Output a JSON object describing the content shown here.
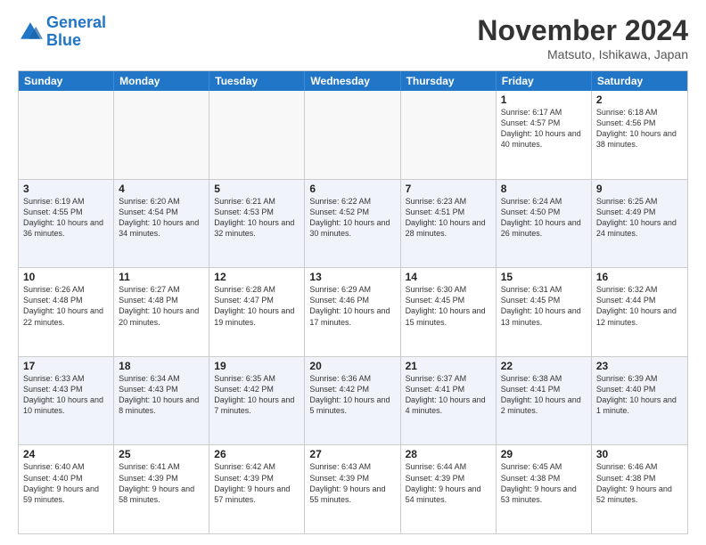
{
  "header": {
    "logo_line1": "General",
    "logo_line2": "Blue",
    "month_title": "November 2024",
    "location": "Matsuto, Ishikawa, Japan"
  },
  "days_of_week": [
    "Sunday",
    "Monday",
    "Tuesday",
    "Wednesday",
    "Thursday",
    "Friday",
    "Saturday"
  ],
  "rows": [
    {
      "alt": false,
      "cells": [
        {
          "day": "",
          "info": ""
        },
        {
          "day": "",
          "info": ""
        },
        {
          "day": "",
          "info": ""
        },
        {
          "day": "",
          "info": ""
        },
        {
          "day": "",
          "info": ""
        },
        {
          "day": "1",
          "info": "Sunrise: 6:17 AM\nSunset: 4:57 PM\nDaylight: 10 hours and 40 minutes."
        },
        {
          "day": "2",
          "info": "Sunrise: 6:18 AM\nSunset: 4:56 PM\nDaylight: 10 hours and 38 minutes."
        }
      ]
    },
    {
      "alt": true,
      "cells": [
        {
          "day": "3",
          "info": "Sunrise: 6:19 AM\nSunset: 4:55 PM\nDaylight: 10 hours and 36 minutes."
        },
        {
          "day": "4",
          "info": "Sunrise: 6:20 AM\nSunset: 4:54 PM\nDaylight: 10 hours and 34 minutes."
        },
        {
          "day": "5",
          "info": "Sunrise: 6:21 AM\nSunset: 4:53 PM\nDaylight: 10 hours and 32 minutes."
        },
        {
          "day": "6",
          "info": "Sunrise: 6:22 AM\nSunset: 4:52 PM\nDaylight: 10 hours and 30 minutes."
        },
        {
          "day": "7",
          "info": "Sunrise: 6:23 AM\nSunset: 4:51 PM\nDaylight: 10 hours and 28 minutes."
        },
        {
          "day": "8",
          "info": "Sunrise: 6:24 AM\nSunset: 4:50 PM\nDaylight: 10 hours and 26 minutes."
        },
        {
          "day": "9",
          "info": "Sunrise: 6:25 AM\nSunset: 4:49 PM\nDaylight: 10 hours and 24 minutes."
        }
      ]
    },
    {
      "alt": false,
      "cells": [
        {
          "day": "10",
          "info": "Sunrise: 6:26 AM\nSunset: 4:48 PM\nDaylight: 10 hours and 22 minutes."
        },
        {
          "day": "11",
          "info": "Sunrise: 6:27 AM\nSunset: 4:48 PM\nDaylight: 10 hours and 20 minutes."
        },
        {
          "day": "12",
          "info": "Sunrise: 6:28 AM\nSunset: 4:47 PM\nDaylight: 10 hours and 19 minutes."
        },
        {
          "day": "13",
          "info": "Sunrise: 6:29 AM\nSunset: 4:46 PM\nDaylight: 10 hours and 17 minutes."
        },
        {
          "day": "14",
          "info": "Sunrise: 6:30 AM\nSunset: 4:45 PM\nDaylight: 10 hours and 15 minutes."
        },
        {
          "day": "15",
          "info": "Sunrise: 6:31 AM\nSunset: 4:45 PM\nDaylight: 10 hours and 13 minutes."
        },
        {
          "day": "16",
          "info": "Sunrise: 6:32 AM\nSunset: 4:44 PM\nDaylight: 10 hours and 12 minutes."
        }
      ]
    },
    {
      "alt": true,
      "cells": [
        {
          "day": "17",
          "info": "Sunrise: 6:33 AM\nSunset: 4:43 PM\nDaylight: 10 hours and 10 minutes."
        },
        {
          "day": "18",
          "info": "Sunrise: 6:34 AM\nSunset: 4:43 PM\nDaylight: 10 hours and 8 minutes."
        },
        {
          "day": "19",
          "info": "Sunrise: 6:35 AM\nSunset: 4:42 PM\nDaylight: 10 hours and 7 minutes."
        },
        {
          "day": "20",
          "info": "Sunrise: 6:36 AM\nSunset: 4:42 PM\nDaylight: 10 hours and 5 minutes."
        },
        {
          "day": "21",
          "info": "Sunrise: 6:37 AM\nSunset: 4:41 PM\nDaylight: 10 hours and 4 minutes."
        },
        {
          "day": "22",
          "info": "Sunrise: 6:38 AM\nSunset: 4:41 PM\nDaylight: 10 hours and 2 minutes."
        },
        {
          "day": "23",
          "info": "Sunrise: 6:39 AM\nSunset: 4:40 PM\nDaylight: 10 hours and 1 minute."
        }
      ]
    },
    {
      "alt": false,
      "cells": [
        {
          "day": "24",
          "info": "Sunrise: 6:40 AM\nSunset: 4:40 PM\nDaylight: 9 hours and 59 minutes."
        },
        {
          "day": "25",
          "info": "Sunrise: 6:41 AM\nSunset: 4:39 PM\nDaylight: 9 hours and 58 minutes."
        },
        {
          "day": "26",
          "info": "Sunrise: 6:42 AM\nSunset: 4:39 PM\nDaylight: 9 hours and 57 minutes."
        },
        {
          "day": "27",
          "info": "Sunrise: 6:43 AM\nSunset: 4:39 PM\nDaylight: 9 hours and 55 minutes."
        },
        {
          "day": "28",
          "info": "Sunrise: 6:44 AM\nSunset: 4:39 PM\nDaylight: 9 hours and 54 minutes."
        },
        {
          "day": "29",
          "info": "Sunrise: 6:45 AM\nSunset: 4:38 PM\nDaylight: 9 hours and 53 minutes."
        },
        {
          "day": "30",
          "info": "Sunrise: 6:46 AM\nSunset: 4:38 PM\nDaylight: 9 hours and 52 minutes."
        }
      ]
    }
  ]
}
